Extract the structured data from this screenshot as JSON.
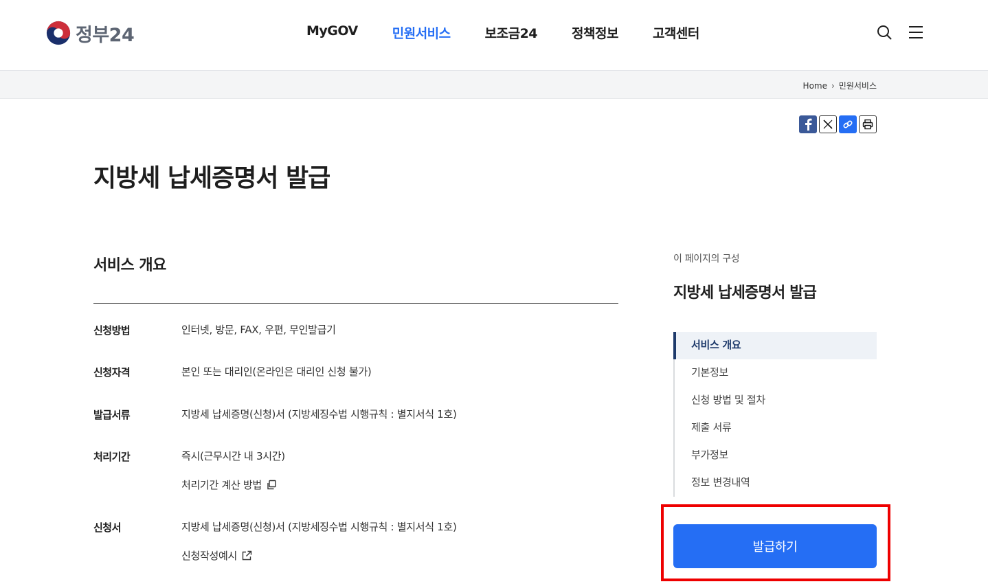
{
  "brand": {
    "name": "정부24"
  },
  "nav": {
    "items": [
      {
        "label": "MyGOV"
      },
      {
        "label": "민원서비스"
      },
      {
        "label": "보조금24"
      },
      {
        "label": "정책정보"
      },
      {
        "label": "고객센터"
      }
    ],
    "active_index": 1
  },
  "header_icons": {
    "search": "search-icon",
    "menu": "hamburger-menu-icon"
  },
  "breadcrumb": {
    "home": "Home",
    "current": "민원서비스"
  },
  "share_icons": [
    "facebook-icon",
    "x-icon",
    "link-icon",
    "print-icon"
  ],
  "page": {
    "title": "지방세 납세증명서 발급"
  },
  "overview": {
    "title": "서비스 개요",
    "rows": [
      {
        "label": "신청방법",
        "values": [
          "인터넷, 방문, FAX, 우편, 무인발급기"
        ]
      },
      {
        "label": "신청자격",
        "values": [
          "본인 또는 대리인(온라인은 대리인 신청 불가)"
        ]
      },
      {
        "label": "발급서류",
        "values": [
          "지방세 납세증명(신청)서 (지방세징수법 시행규칙 : 별지서식 1호)"
        ]
      },
      {
        "label": "처리기간",
        "values": [
          "즉시(근무시간 내 3시간)"
        ],
        "link": "처리기간 계산 방법"
      },
      {
        "label": "신청서",
        "values": [
          "지방세 납세증명(신청)서 (지방세징수법 시행규칙 : 별지서식 1호)"
        ],
        "link": "신청작성예시"
      }
    ]
  },
  "toc": {
    "caption": "이 페이지의 구성",
    "title": "지방세 납세증명서 발급",
    "items": [
      {
        "label": "서비스 개요"
      },
      {
        "label": "기본정보"
      },
      {
        "label": "신청 방법 및 절차"
      },
      {
        "label": "제출 서류"
      },
      {
        "label": "부가정보"
      },
      {
        "label": "정보 변경내역"
      }
    ],
    "active_index": 0
  },
  "cta": {
    "label": "발급하기"
  },
  "colors": {
    "accent": "#256ef4",
    "highlight": "#ee0000",
    "toc_active": "#1e3a6b",
    "facebook": "#3b5998"
  }
}
